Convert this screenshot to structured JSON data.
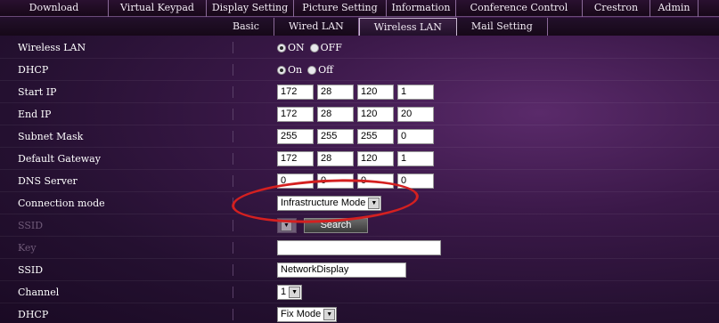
{
  "top_menu": [
    {
      "label": "Download"
    },
    {
      "label": "Virtual Keypad"
    },
    {
      "label": "Display Setting"
    },
    {
      "label": "Picture Setting"
    },
    {
      "label": "Information"
    },
    {
      "label": "Conference Control"
    },
    {
      "label": "Crestron"
    },
    {
      "label": "Admin"
    }
  ],
  "sub_menu": [
    {
      "label": "Basic"
    },
    {
      "label": "Wired LAN"
    },
    {
      "label": "Wireless LAN",
      "active": true
    },
    {
      "label": "Mail Setting"
    }
  ],
  "form": {
    "wireless_lan": {
      "label": "Wireless LAN",
      "on": "ON",
      "off": "OFF",
      "selected": "ON"
    },
    "dhcp": {
      "label": "DHCP",
      "on": "On",
      "off": "Off",
      "selected": "On"
    },
    "start_ip": {
      "label": "Start IP",
      "octets": [
        "172",
        "28",
        "120",
        "1"
      ]
    },
    "end_ip": {
      "label": "End IP",
      "octets": [
        "172",
        "28",
        "120",
        "20"
      ]
    },
    "subnet_mask": {
      "label": "Subnet Mask",
      "octets": [
        "255",
        "255",
        "255",
        "0"
      ]
    },
    "default_gateway": {
      "label": "Default Gateway",
      "octets": [
        "172",
        "28",
        "120",
        "1"
      ]
    },
    "dns_server": {
      "label": "DNS Server",
      "octets": [
        "0",
        "0",
        "0",
        "0"
      ]
    },
    "connection_mode": {
      "label": "Connection mode",
      "value": "Infrastructure Mode"
    },
    "ssid_scan": {
      "label": "SSID",
      "search_label": "Search"
    },
    "key": {
      "label": "Key",
      "value": ""
    },
    "ssid": {
      "label": "SSID",
      "value": "NetworkDisplay"
    },
    "channel": {
      "label": "Channel",
      "value": "1"
    },
    "dhcp2": {
      "label": "DHCP",
      "value": "Fix Mode"
    }
  },
  "colors": {
    "highlight_ellipse": "#d42020"
  }
}
